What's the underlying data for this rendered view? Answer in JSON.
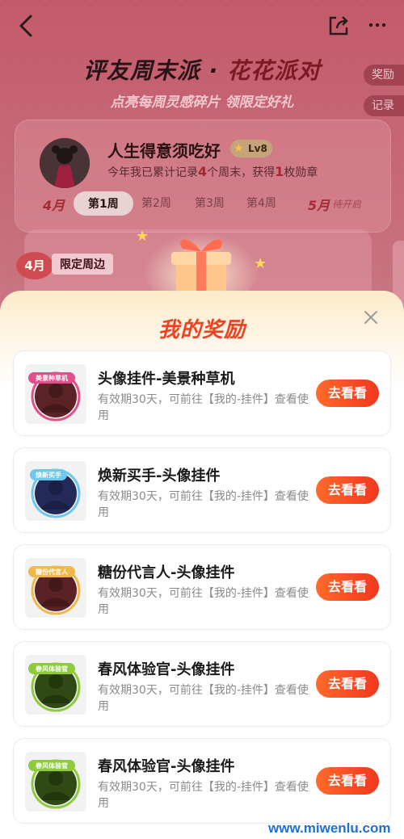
{
  "background": {
    "event": {
      "title_part1": "评友周末派 · ",
      "title_part2": "花花派对",
      "subtitle": "点亮每周灵感碎片 领限定好礼"
    },
    "side_tabs": [
      "奖励",
      "记录"
    ],
    "user": {
      "name": "人生得意须吃好",
      "level": "Lv8",
      "stats_prefix": "今年我已累计记录",
      "weeks": "4",
      "stats_middle": "个周末，获得",
      "badges": "1",
      "stats_suffix": "枚勋章"
    },
    "months": {
      "current": "4月",
      "next": "5月",
      "next_status": "待开启"
    },
    "weeks": [
      "第1周",
      "第2周",
      "第3周",
      "第4周"
    ],
    "active_week_index": 0,
    "peek": {
      "badge": "4月",
      "label": "限定周边"
    }
  },
  "modal": {
    "title": "我的奖励",
    "rewards": [
      {
        "name": "头像挂件-美景种草机",
        "desc": "有效期30天，可前往【我的-挂件】查看使用",
        "button": "去看看",
        "ring_color": "#e0508a",
        "face_color": "#5b2326",
        "tag_text": "美景种草机"
      },
      {
        "name": "焕新买手-头像挂件",
        "desc": "有效期30天，可前往【我的-挂件】查看使用",
        "button": "去看看",
        "ring_color": "#6ec7ef",
        "face_color": "#232a5a",
        "tag_text": "焕新买手"
      },
      {
        "name": "糖份代言人-头像挂件",
        "desc": "有效期30天，可前往【我的-挂件】查看使用",
        "button": "去看看",
        "ring_color": "#f0b84a",
        "face_color": "#5a2226",
        "tag_text": "糖份代言人"
      },
      {
        "name": "春风体验官-头像挂件",
        "desc": "有效期30天，可前往【我的-挂件】查看使用",
        "button": "去看看",
        "ring_color": "#8ecb3c",
        "face_color": "#2f4a12",
        "tag_text": "春风体验官"
      },
      {
        "name": "春风体验官-头像挂件",
        "desc": "有效期30天，可前往【我的-挂件】查看使用",
        "button": "去看看",
        "ring_color": "#8ecb3c",
        "face_color": "#2f4a12",
        "tag_text": "春风体验官"
      }
    ]
  },
  "watermark": "www.miwenlu.com",
  "colors": {
    "accent": "#f2361e",
    "modal_title": "#f04222"
  }
}
